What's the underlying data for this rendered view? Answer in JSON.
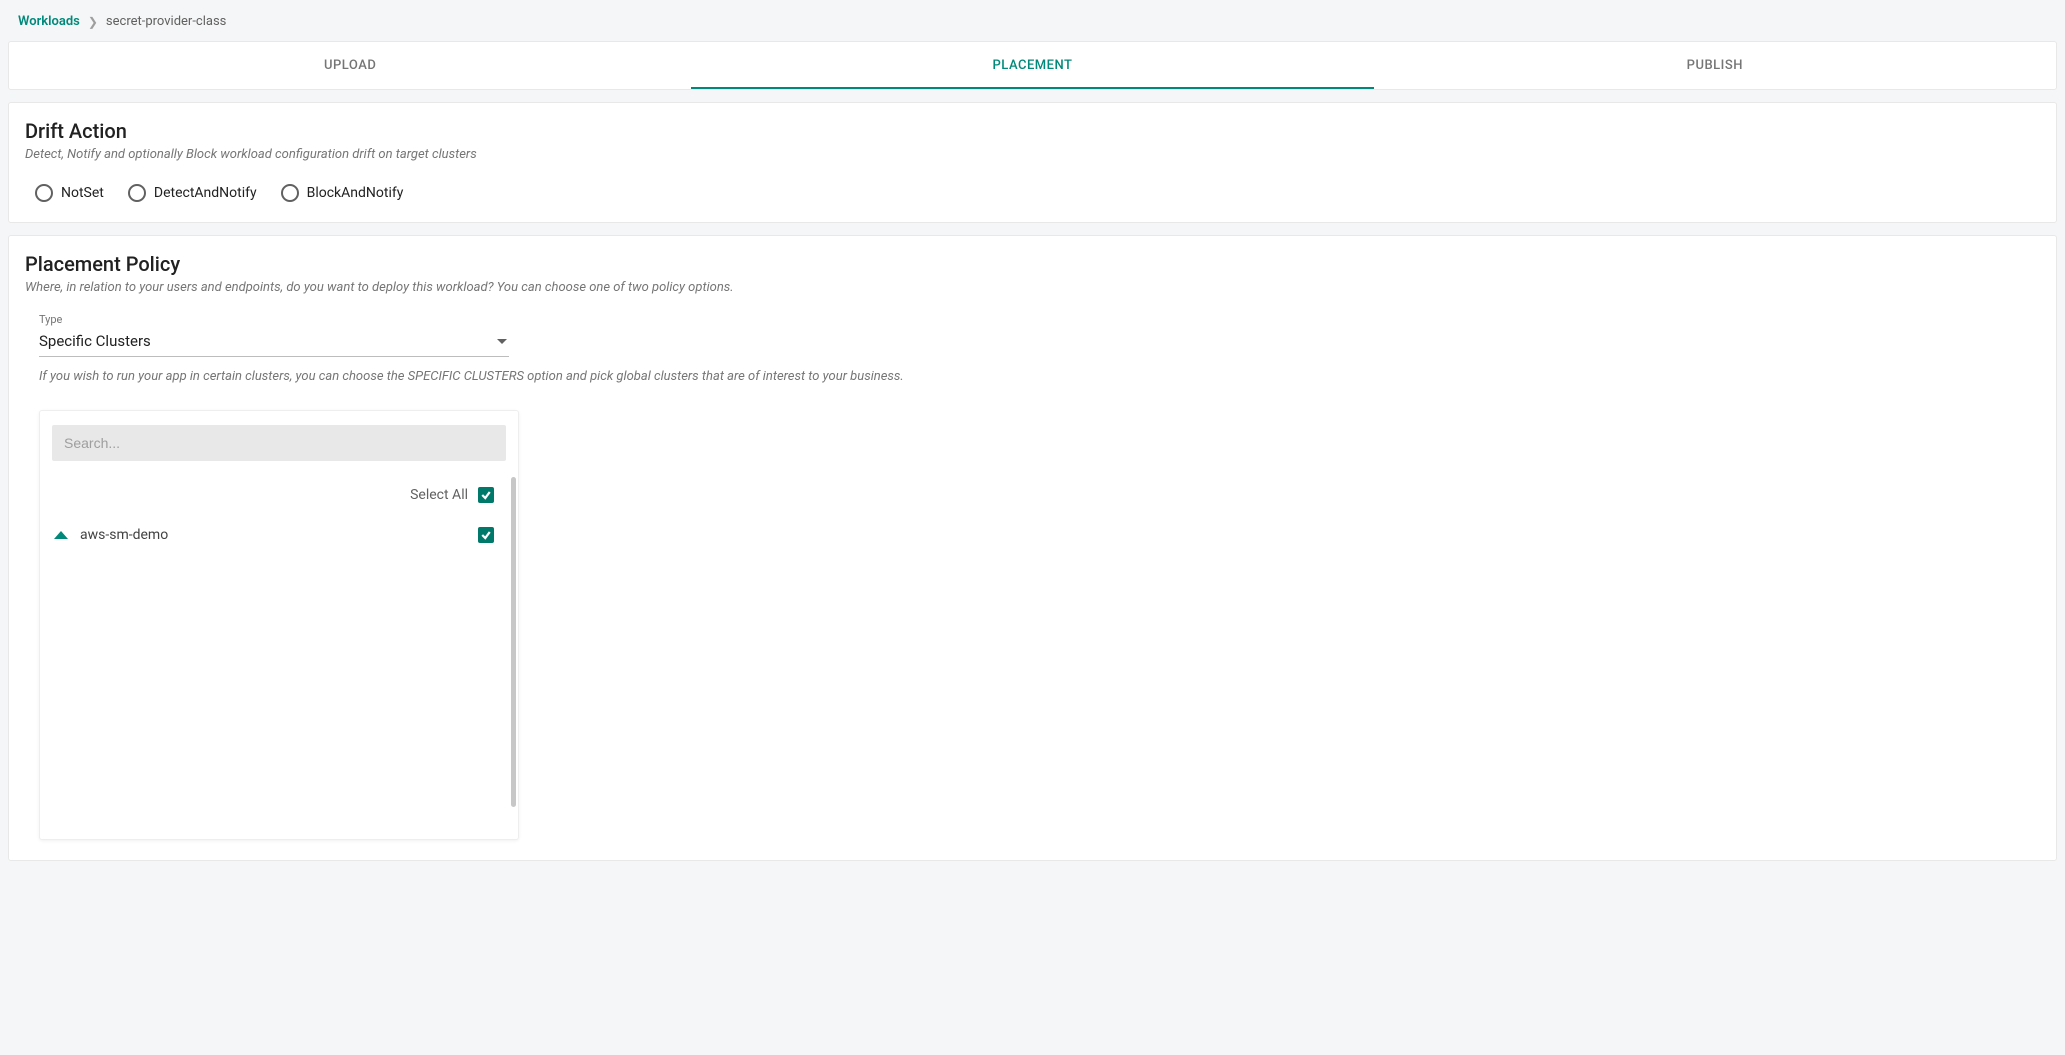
{
  "breadcrumb": {
    "root": "Workloads",
    "current": "secret-provider-class"
  },
  "tabs": [
    {
      "label": "UPLOAD",
      "active": false
    },
    {
      "label": "PLACEMENT",
      "active": true
    },
    {
      "label": "PUBLISH",
      "active": false
    }
  ],
  "drift": {
    "title": "Drift Action",
    "desc": "Detect, Notify and optionally Block workload configuration drift on target clusters",
    "options": [
      "NotSet",
      "DetectAndNotify",
      "BlockAndNotify"
    ]
  },
  "placement": {
    "title": "Placement Policy",
    "desc": "Where, in relation to your users and endpoints, do you want to deploy this workload? You can choose one of two policy options.",
    "type_label": "Type",
    "type_value": "Specific Clusters",
    "help": "If you wish to run your app in certain clusters, you can choose the SPECIFIC CLUSTERS option and pick global clusters that are of interest to your business.",
    "search_placeholder": "Search...",
    "select_all_label": "Select All",
    "items": [
      {
        "name": "aws-sm-demo",
        "checked": true
      }
    ]
  }
}
